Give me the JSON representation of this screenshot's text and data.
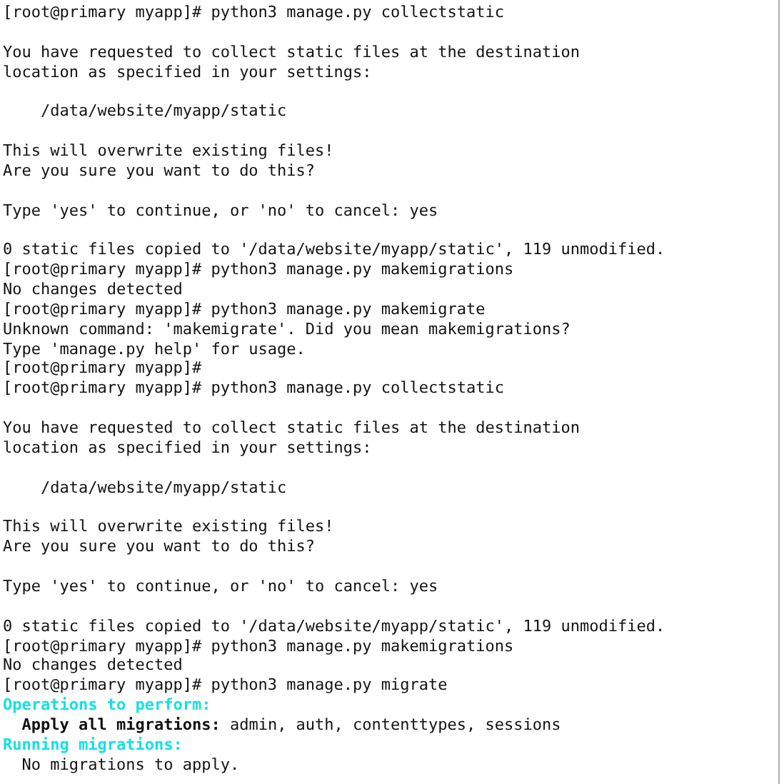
{
  "terminal": {
    "blocks": [
      {
        "lines": [
          {
            "text": "[root@primary myapp]# python3 manage.py collectstatic",
            "kind": "plain"
          }
        ]
      },
      {
        "lines": [
          {
            "text": "You have requested to collect static files at the destination",
            "kind": "plain"
          },
          {
            "text": "location as specified in your settings:",
            "kind": "plain"
          }
        ]
      },
      {
        "lines": [
          {
            "text": "    /data/website/myapp/static",
            "kind": "plain"
          }
        ]
      },
      {
        "lines": [
          {
            "text": "This will overwrite existing files!",
            "kind": "plain"
          },
          {
            "text": "Are you sure you want to do this?",
            "kind": "plain"
          }
        ]
      },
      {
        "lines": [
          {
            "text": "Type 'yes' to continue, or 'no' to cancel: yes",
            "kind": "plain"
          }
        ]
      },
      {
        "lines": [
          {
            "text": "0 static files copied to '/data/website/myapp/static', 119 unmodified.",
            "kind": "plain"
          },
          {
            "text": "[root@primary myapp]# python3 manage.py makemigrations",
            "kind": "plain"
          },
          {
            "text": "No changes detected",
            "kind": "plain"
          },
          {
            "text": "[root@primary myapp]# python3 manage.py makemigrate",
            "kind": "plain"
          },
          {
            "text": "Unknown command: 'makemigrate'. Did you mean makemigrations?",
            "kind": "plain"
          },
          {
            "text": "Type 'manage.py help' for usage.",
            "kind": "plain"
          },
          {
            "text": "[root@primary myapp]#",
            "kind": "plain"
          },
          {
            "text": "[root@primary myapp]# python3 manage.py collectstatic",
            "kind": "plain"
          }
        ]
      },
      {
        "lines": [
          {
            "text": "You have requested to collect static files at the destination",
            "kind": "plain"
          },
          {
            "text": "location as specified in your settings:",
            "kind": "plain"
          }
        ]
      },
      {
        "lines": [
          {
            "text": "    /data/website/myapp/static",
            "kind": "plain"
          }
        ]
      },
      {
        "lines": [
          {
            "text": "This will overwrite existing files!",
            "kind": "plain"
          },
          {
            "text": "Are you sure you want to do this?",
            "kind": "plain"
          }
        ]
      },
      {
        "lines": [
          {
            "text": "Type 'yes' to continue, or 'no' to cancel: yes",
            "kind": "plain"
          }
        ]
      },
      {
        "lines": [
          {
            "text": "0 static files copied to '/data/website/myapp/static', 119 unmodified.",
            "kind": "plain"
          },
          {
            "text": "[root@primary myapp]# python3 manage.py makemigrations",
            "kind": "plain"
          },
          {
            "text": "No changes detected",
            "kind": "plain"
          },
          {
            "text": "[root@primary myapp]# python3 manage.py migrate",
            "kind": "plain"
          },
          {
            "text": "Operations to perform:",
            "kind": "notice"
          },
          {
            "text": "  **Apply all migrations:** admin, auth, contenttypes, sessions",
            "kind": "plain"
          },
          {
            "text": "Running migrations:",
            "kind": "notice"
          },
          {
            "text": "  No migrations to apply.",
            "kind": "plain"
          }
        ]
      }
    ]
  }
}
